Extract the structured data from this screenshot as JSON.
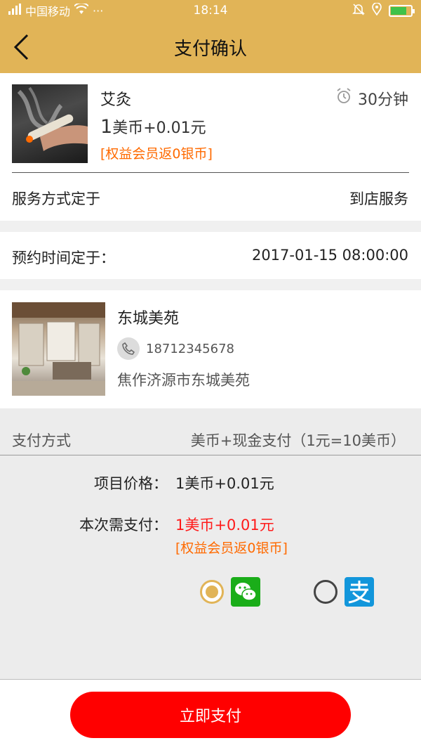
{
  "status_bar": {
    "carrier": "中国移动",
    "dots": "···",
    "time": "18:14"
  },
  "header": {
    "title": "支付确认"
  },
  "service": {
    "title": "艾灸",
    "duration": "30分钟",
    "price_number": "1",
    "price_rest": "美币+0.01元",
    "rebate": "[权益会员返0银币]",
    "mode_label": "服务方式定于",
    "mode_value": "到店服务"
  },
  "appointment": {
    "label": "预约时间定于：",
    "value": "2017-01-15 08:00:00"
  },
  "shop": {
    "name": "东城美苑",
    "phone": "18712345678",
    "address": "焦作济源市东城美苑"
  },
  "payment": {
    "method_label": "支付方式",
    "method_value": "美币+现金支付（1元=10美币）",
    "item_price_label": "项目价格：",
    "item_price_value": "1美币+0.01元",
    "due_label": "本次需支付：",
    "due_value": "1美币+0.01元",
    "due_rebate": "[权益会员返0银币]",
    "options": [
      {
        "name": "wechat",
        "selected": true
      },
      {
        "name": "alipay",
        "selected": false
      }
    ]
  },
  "footer": {
    "pay_button_label": "立即支付"
  },
  "colors": {
    "accent": "#e1b457",
    "price_red": "#ff1a1a",
    "rebate_orange": "#ff6a00",
    "pay_button": "#ff0000",
    "wechat_green": "#1aad19",
    "alipay_blue": "#1296db"
  }
}
